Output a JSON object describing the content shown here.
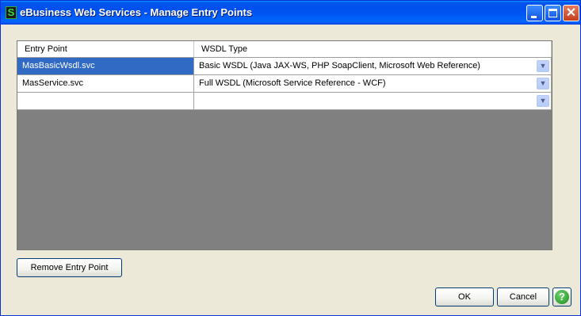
{
  "window": {
    "title": "eBusiness Web Services - Manage Entry Points",
    "app_icon_letter": "S",
    "close_glyph": "✕"
  },
  "grid": {
    "columns": [
      "Entry Point",
      "WSDL Type"
    ],
    "rows": [
      {
        "entry_point": "MasBasicWsdl.svc",
        "wsdl_type": "Basic WSDL (Java JAX-WS, PHP SoapClient, Microsoft Web Reference)",
        "selected": true
      },
      {
        "entry_point": "MasService.svc",
        "wsdl_type": "Full WSDL (Microsoft Service Reference - WCF)",
        "selected": false
      },
      {
        "entry_point": "",
        "wsdl_type": "",
        "selected": false
      }
    ],
    "dropdown_glyph": "▼"
  },
  "buttons": {
    "remove_entry_point": "Remove Entry Point",
    "ok": "OK",
    "cancel": "Cancel",
    "help_glyph": "?"
  },
  "colors": {
    "selected_row": "#316ac5",
    "title_bar": "#0053ee",
    "grid_background": "#808080"
  }
}
